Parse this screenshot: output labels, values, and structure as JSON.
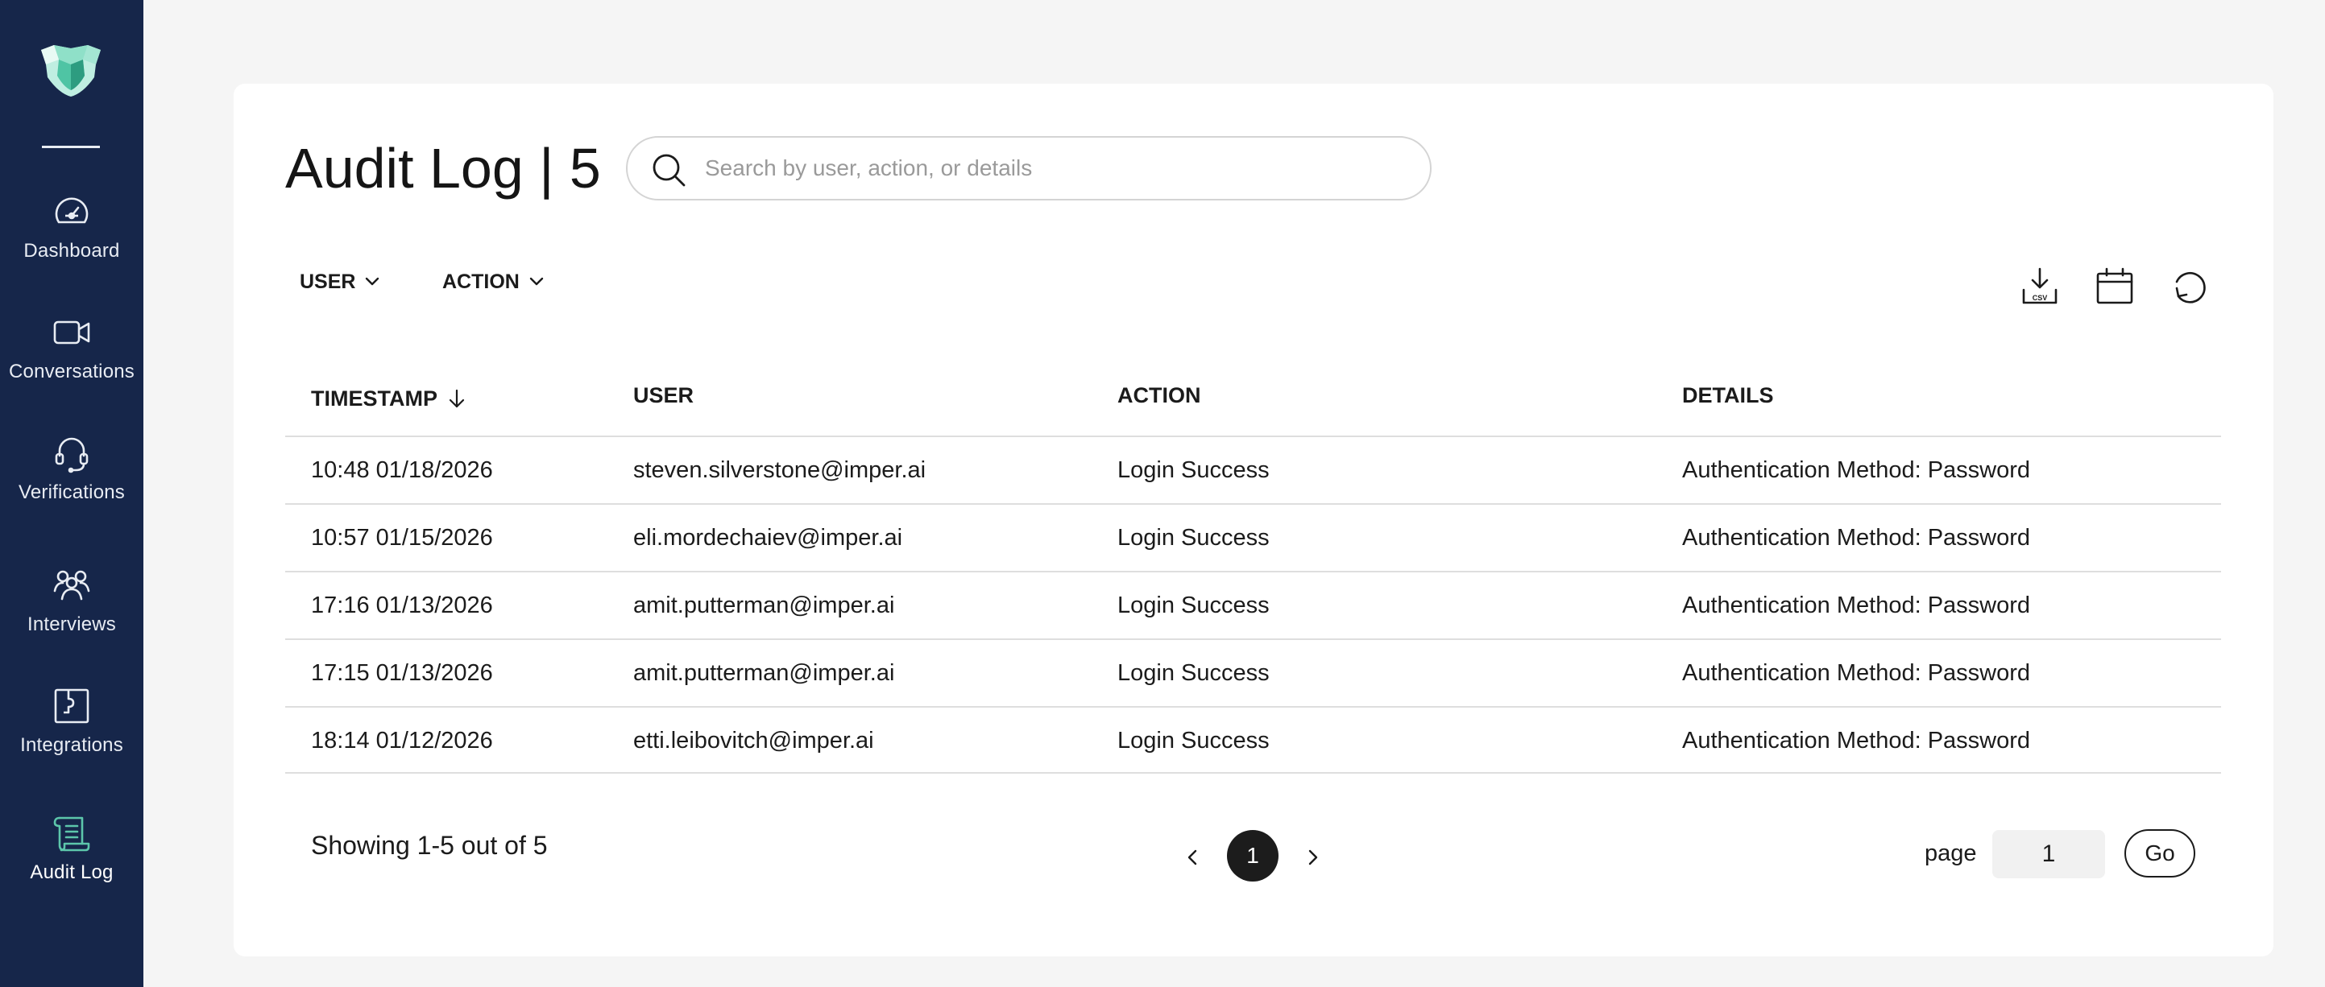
{
  "sidebar": {
    "logo": "shield-logo-icon",
    "items": [
      {
        "label": "Dashboard",
        "icon": "speedometer-icon"
      },
      {
        "label": "Conversations",
        "icon": "video-camera-icon"
      },
      {
        "label": "Verifications",
        "icon": "headset-icon"
      },
      {
        "label": "Interviews",
        "icon": "users-group-icon"
      },
      {
        "label": "Integrations",
        "icon": "puzzle-icon"
      },
      {
        "label": "Audit Log",
        "icon": "scroll-icon",
        "active": true
      }
    ]
  },
  "header": {
    "title": "Audit Log | 5",
    "search_placeholder": "Search by user, action, or details"
  },
  "filters": {
    "user_label": "USER",
    "action_label": "ACTION"
  },
  "tools": {
    "csv_icon_text": "CSV",
    "icons": [
      "download-csv-icon",
      "calendar-icon",
      "refresh-icon"
    ]
  },
  "table": {
    "columns": [
      "TIMESTAMP",
      "USER",
      "ACTION",
      "DETAILS"
    ],
    "rows": [
      {
        "timestamp": "10:48 01/18/2026",
        "user": "steven.silverstone@imper.ai",
        "action": "Login Success",
        "details": "Authentication Method: Password"
      },
      {
        "timestamp": "10:57 01/15/2026",
        "user": "eli.mordechaiev@imper.ai",
        "action": "Login Success",
        "details": "Authentication Method: Password"
      },
      {
        "timestamp": "17:16 01/13/2026",
        "user": "amit.putterman@imper.ai",
        "action": "Login Success",
        "details": "Authentication Method: Password"
      },
      {
        "timestamp": "17:15 01/13/2026",
        "user": "amit.putterman@imper.ai",
        "action": "Login Success",
        "details": "Authentication Method: Password"
      },
      {
        "timestamp": "18:14 01/12/2026",
        "user": "etti.leibovitch@imper.ai",
        "action": "Login Success",
        "details": "Authentication Method: Password"
      }
    ]
  },
  "footer": {
    "showing": "Showing 1-5 out of 5",
    "current_page": "1",
    "page_label": "page",
    "page_value": "1",
    "go_label": "Go"
  },
  "colors": {
    "sidebar_bg": "#16264a",
    "accent": "#5cc6ab",
    "page_bg": "#f5f5f5"
  }
}
